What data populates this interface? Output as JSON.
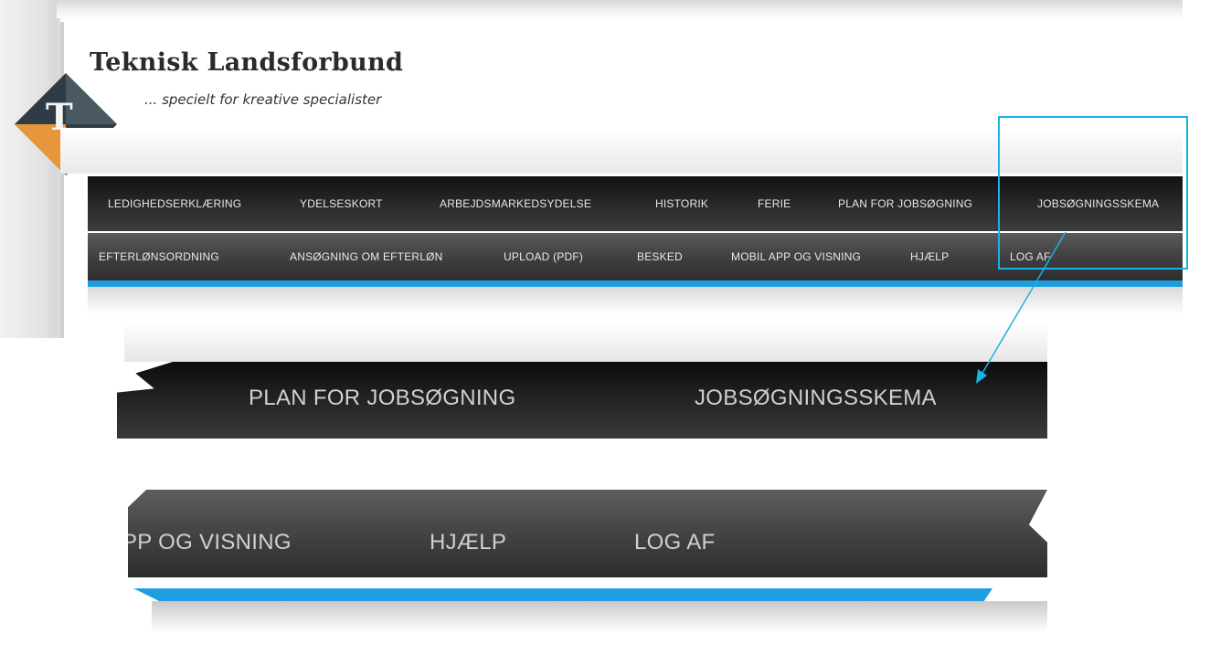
{
  "brand": {
    "title": "Teknisk Landsforbund",
    "tagline": "... specielt for kreative specialister",
    "logo_letter": "T"
  },
  "nav": {
    "row1": [
      "LEDIGHEDSERKLÆRING",
      "YDELSESKORT",
      "ARBEJDSMARKEDSYDELSE",
      "HISTORIK",
      "FERIE",
      "PLAN FOR JOBSØGNING",
      "JOBSØGNINGSSKEMA"
    ],
    "row2": [
      "EFTERLØNSORDNING",
      "ANSØGNING OM EFTERLØN",
      "UPLOAD (PDF)",
      "BESKED",
      "MOBIL APP OG VISNING",
      "HJÆLP",
      "LOG AF"
    ]
  },
  "zoom": {
    "row1": [
      "PLAN FOR JOBSØGNING",
      "JOBSØGNINGSSKEMA"
    ],
    "row2": [
      "PP OG VISNING",
      "HJÆLP",
      "LOG AF"
    ]
  },
  "colors": {
    "accent": "#1e9ee0",
    "callout": "#18b4e6",
    "logo_orange": "#e8963a",
    "logo_dark": "#2f3b45"
  }
}
